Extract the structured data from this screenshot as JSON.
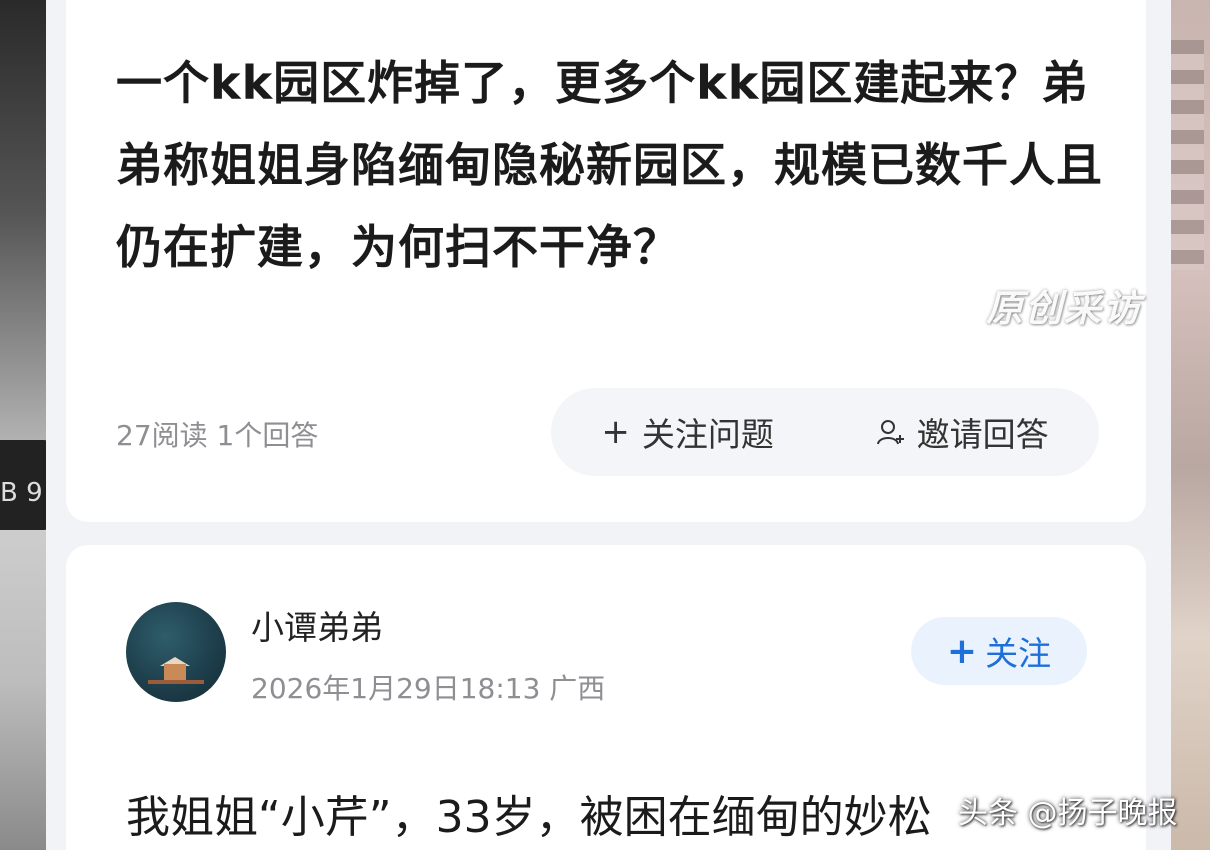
{
  "question": {
    "title": "一个kk园区炸掉了，更多个kk园区建起来？弟弟称姐姐身陷缅甸隐秘新园区，规模已数千人且仍在扩建，为何扫不干净？",
    "stats": "27阅读 1个回答",
    "follow_label": "关注问题",
    "invite_label": "邀请回答"
  },
  "answer": {
    "author_name": "小谭弟弟",
    "meta": "2026年1月29日18:13  广西",
    "follow_label": "关注",
    "text": "我姐姐“小芹”，33岁，被困在缅甸的妙松"
  },
  "watermarks": {
    "top": "原创采访",
    "bottom": "头条 @扬子晚报"
  },
  "background": {
    "plate_text": "B 9"
  },
  "colors": {
    "accent": "#1e6fd9",
    "follow_bg": "#eaf3fd",
    "muted_text": "#8e8e93"
  },
  "icons": {
    "plus": "plus-icon",
    "invite": "person-plus-icon"
  }
}
